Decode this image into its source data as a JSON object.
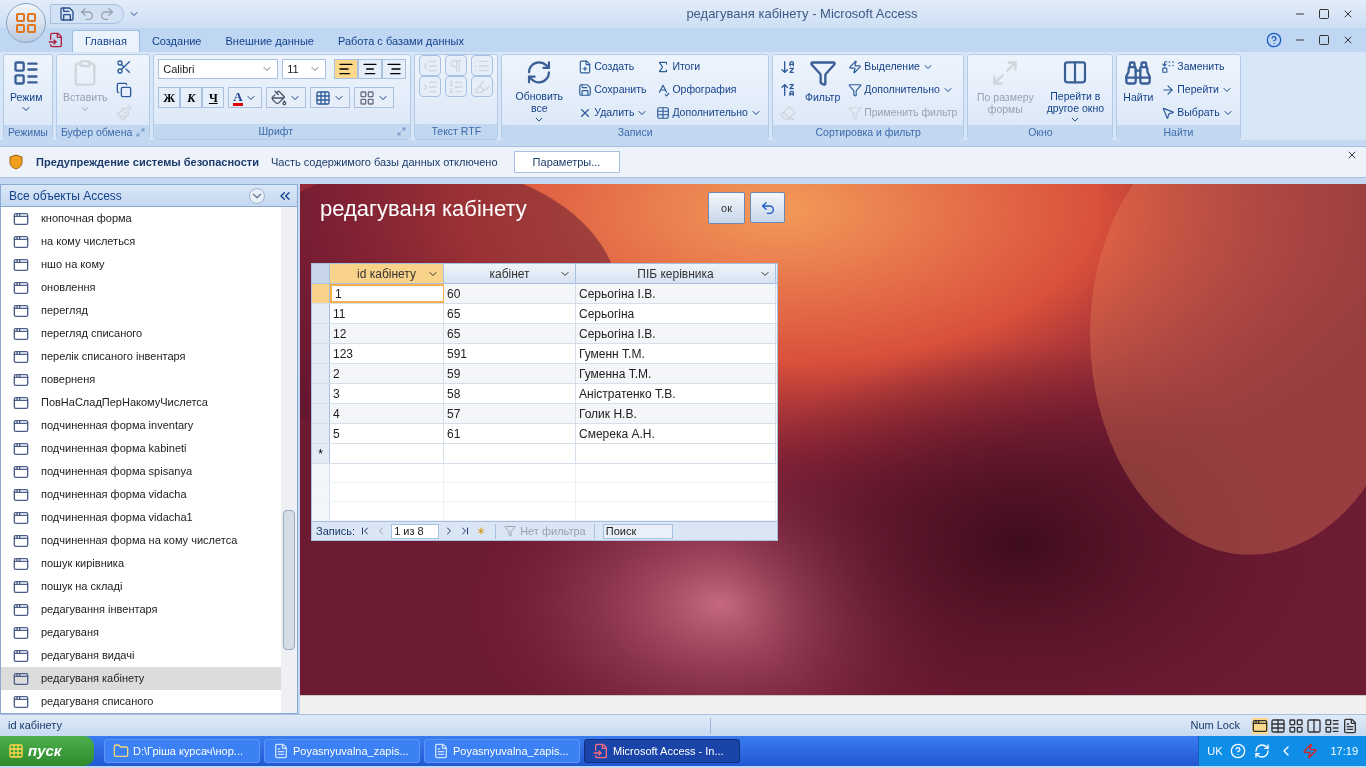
{
  "title_bar": {
    "title": "редагуваня кабінету - Microsoft Access"
  },
  "ribbon_tabs": [
    {
      "label": "Главная",
      "selected": true
    },
    {
      "label": "Создание",
      "selected": false
    },
    {
      "label": "Внешние данные",
      "selected": false
    },
    {
      "label": "Работа с базами данных",
      "selected": false
    }
  ],
  "ribbon_groups": [
    {
      "kind": "buttons",
      "label": "Режимы",
      "launcher": false,
      "items": [
        {
          "kind": "large",
          "label": "Режим",
          "dropdown": true,
          "disabled": false
        }
      ]
    },
    {
      "kind": "buttons",
      "label": "Буфер обмена",
      "launcher": true,
      "items": [
        {
          "kind": "large",
          "label": "Вставить",
          "dropdown": true,
          "disabled": true
        },
        {
          "kind": "icon",
          "disabled": false
        },
        {
          "kind": "icon",
          "disabled": false
        },
        {
          "kind": "icon",
          "disabled": true
        }
      ]
    },
    {
      "kind": "font",
      "label": "Шрифт",
      "launcher": true,
      "font": "Calibri",
      "size": "11",
      "align": [
        {
          "selected": true
        },
        {
          "selected": false
        },
        {
          "selected": false
        }
      ],
      "format": [
        "Ж",
        "К",
        "Ч"
      ],
      "font_color": "A"
    },
    {
      "kind": "rtf",
      "label": "Текст RTF",
      "launcher": false,
      "items": [
        {
          "kind": "icon",
          "disabled": true
        },
        {
          "kind": "icon",
          "disabled": true
        },
        {
          "kind": "icon",
          "disabled": true
        },
        {
          "kind": "icon",
          "disabled": true
        },
        {
          "kind": "icon",
          "disabled": true
        },
        {
          "kind": "icon",
          "disabled": true
        }
      ]
    },
    {
      "kind": "buttons",
      "label": "Записи",
      "launcher": false,
      "items": [
        {
          "kind": "large",
          "label": "Обновить все",
          "dropdown": true,
          "disabled": false
        },
        {
          "kind": "small",
          "label": "Создать",
          "dropdown": false,
          "disabled": false
        },
        {
          "kind": "small",
          "label": "Сохранить",
          "dropdown": false,
          "disabled": false
        },
        {
          "kind": "small",
          "label": "Удалить",
          "dropdown": true,
          "disabled": false
        },
        {
          "kind": "small",
          "label": "Итоги",
          "dropdown": false,
          "disabled": false
        },
        {
          "kind": "small",
          "label": "Орфография",
          "dropdown": false,
          "disabled": false
        },
        {
          "kind": "small",
          "label": "Дополнительно",
          "dropdown": true,
          "disabled": false
        }
      ]
    },
    {
      "kind": "buttons",
      "label": "Сортировка и фильтр",
      "launcher": false,
      "items": [
        {
          "kind": "icon",
          "disabled": false
        },
        {
          "kind": "icon",
          "disabled": false
        },
        {
          "kind": "icon",
          "disabled": true
        },
        {
          "kind": "large",
          "label": "Фильтр",
          "dropdown": false,
          "disabled": false
        },
        {
          "kind": "small",
          "label": "Выделение",
          "dropdown": true,
          "disabled": false
        },
        {
          "kind": "small",
          "label": "Дополнительно",
          "dropdown": true,
          "disabled": false
        },
        {
          "kind": "small",
          "label": "Применить фильтр",
          "dropdown": false,
          "disabled": true
        }
      ]
    },
    {
      "kind": "buttons",
      "label": "Окно",
      "launcher": false,
      "items": [
        {
          "kind": "large",
          "label": "По размеру формы",
          "dropdown": false,
          "disabled": true
        },
        {
          "kind": "large",
          "label": "Перейти в другое окно",
          "dropdown": true,
          "disabled": false
        }
      ]
    },
    {
      "kind": "buttons",
      "label": "Найти",
      "launcher": false,
      "items": [
        {
          "kind": "large",
          "label": "Найти",
          "dropdown": false,
          "disabled": false
        },
        {
          "kind": "small",
          "label": "Заменить",
          "dropdown": false,
          "disabled": false
        },
        {
          "kind": "small",
          "label": "Перейти",
          "dropdown": true,
          "disabled": false
        },
        {
          "kind": "small",
          "label": "Выбрать",
          "dropdown": true,
          "disabled": false
        }
      ]
    }
  ],
  "security_bar": {
    "title": "Предупреждение системы безопасности",
    "message": "Часть содержимого базы данных отключено",
    "button": "Параметры..."
  },
  "nav_pane": {
    "header": "Все объекты Access",
    "items": [
      {
        "label": "кнопочная форма",
        "selected": false
      },
      {
        "label": "на кому числеться",
        "selected": false
      },
      {
        "label": "ншо на кому",
        "selected": false
      },
      {
        "label": "оновлення",
        "selected": false
      },
      {
        "label": "перегляд",
        "selected": false
      },
      {
        "label": "перегляд списаного",
        "selected": false
      },
      {
        "label": "перелік списаного інвентаря",
        "selected": false
      },
      {
        "label": "поверненя",
        "selected": false
      },
      {
        "label": "ПовНаСладПерНакомуЧислетса",
        "selected": false
      },
      {
        "label": "подчиненная форма inventary",
        "selected": false
      },
      {
        "label": "подчиненная форма kabineti",
        "selected": false
      },
      {
        "label": "подчиненная форма spisanya",
        "selected": false
      },
      {
        "label": "подчиненная форма vidacha",
        "selected": false
      },
      {
        "label": "подчиненная форма vidacha1",
        "selected": false
      },
      {
        "label": "подчиненная форма на кому числетса",
        "selected": false
      },
      {
        "label": "пошук кирівника",
        "selected": false
      },
      {
        "label": "пошук на складі",
        "selected": false
      },
      {
        "label": "редагування інвентаря",
        "selected": false
      },
      {
        "label": "редагуваня",
        "selected": false
      },
      {
        "label": "редагуваня видачі",
        "selected": false
      },
      {
        "label": "редагуваня кабінету",
        "selected": true
      },
      {
        "label": "редагуваня списаного",
        "selected": false
      }
    ]
  },
  "form": {
    "title": "редагуваня кабінету",
    "ok_button": "ок",
    "table": {
      "columns": [
        "id кабінету",
        "кабінет",
        "ПІБ керівника"
      ],
      "rows": [
        {
          "cells": [
            "1",
            "60",
            "Серьогіна І.В."
          ],
          "selected": true
        },
        {
          "cells": [
            "11",
            "65",
            "Серьогіна"
          ],
          "selected": false
        },
        {
          "cells": [
            "12",
            "65",
            "Серьогіна І.В."
          ],
          "selected": false
        },
        {
          "cells": [
            "123",
            "591",
            "Гуменн Т.М."
          ],
          "selected": false
        },
        {
          "cells": [
            "2",
            "59",
            "Гуменна Т.М."
          ],
          "selected": false
        },
        {
          "cells": [
            "3",
            "58",
            "Аністратенко Т.В."
          ],
          "selected": false
        },
        {
          "cells": [
            "4",
            "57",
            "Голик Н.В."
          ],
          "selected": false
        },
        {
          "cells": [
            "5",
            "61",
            "Смерека А.Н."
          ],
          "selected": false
        }
      ],
      "new_row_marker": "*",
      "navigation": {
        "label": "Запись:",
        "position": "1 из 8",
        "filter": "Нет фильтра",
        "search_placeholder": "Поиск"
      }
    }
  },
  "status_bar": {
    "text": "id кабінету",
    "num_lock": "Num Lock"
  },
  "taskbar": {
    "start": "пуск",
    "tasks": [
      {
        "label": "D:\\Гріша курсач\\нор...",
        "selected": false
      },
      {
        "label": "Poyasnyuvalna_zapis...",
        "selected": false
      },
      {
        "label": "Poyasnyuvalna_zapis...",
        "selected": false
      },
      {
        "label": "Microsoft Access - In...",
        "selected": true
      }
    ],
    "language": "UK",
    "time": "17:19"
  }
}
